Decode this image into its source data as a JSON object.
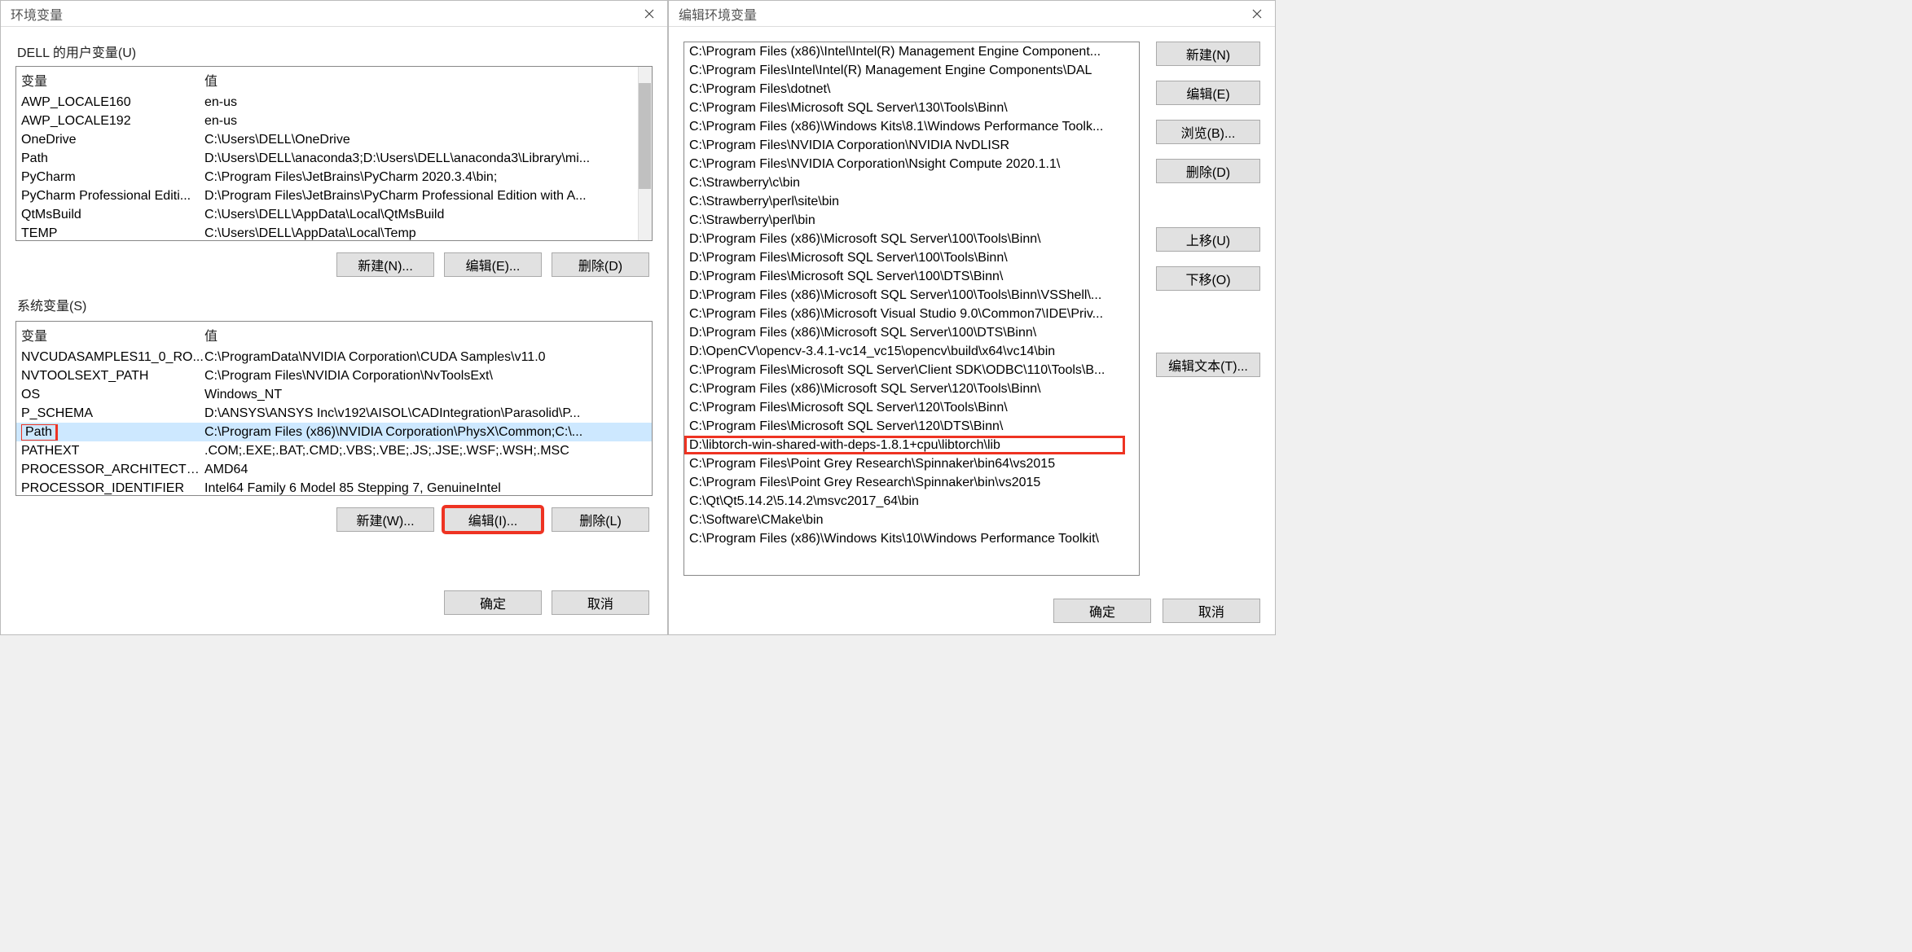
{
  "left_dialog": {
    "title": "环境变量",
    "user_section_label": "DELL 的用户变量(U)",
    "sys_section_label": "系统变量(S)",
    "col_var": "变量",
    "col_val": "值",
    "user_vars": [
      {
        "name": "AWP_LOCALE160",
        "value": "en-us"
      },
      {
        "name": "AWP_LOCALE192",
        "value": "en-us"
      },
      {
        "name": "OneDrive",
        "value": "C:\\Users\\DELL\\OneDrive"
      },
      {
        "name": "Path",
        "value": "D:\\Users\\DELL\\anaconda3;D:\\Users\\DELL\\anaconda3\\Library\\mi..."
      },
      {
        "name": "PyCharm",
        "value": "C:\\Program Files\\JetBrains\\PyCharm 2020.3.4\\bin;"
      },
      {
        "name": "PyCharm Professional Editi...",
        "value": "D:\\Program Files\\JetBrains\\PyCharm Professional Edition with A..."
      },
      {
        "name": "QtMsBuild",
        "value": "C:\\Users\\DELL\\AppData\\Local\\QtMsBuild"
      },
      {
        "name": "TEMP",
        "value": "C:\\Users\\DELL\\AppData\\Local\\Temp"
      }
    ],
    "sys_vars": [
      {
        "name": "NVCUDASAMPLES11_0_RO...",
        "value": "C:\\ProgramData\\NVIDIA Corporation\\CUDA Samples\\v11.0"
      },
      {
        "name": "NVTOOLSEXT_PATH",
        "value": "C:\\Program Files\\NVIDIA Corporation\\NvToolsExt\\"
      },
      {
        "name": "OS",
        "value": "Windows_NT"
      },
      {
        "name": "P_SCHEMA",
        "value": "D:\\ANSYS\\ANSYS Inc\\v192\\AISOL\\CADIntegration\\Parasolid\\P..."
      },
      {
        "name": "Path",
        "value": "C:\\Program Files (x86)\\NVIDIA Corporation\\PhysX\\Common;C:\\...",
        "highlight": true,
        "selected": true
      },
      {
        "name": "PATHEXT",
        "value": ".COM;.EXE;.BAT;.CMD;.VBS;.VBE;.JS;.JSE;.WSF;.WSH;.MSC"
      },
      {
        "name": "PROCESSOR_ARCHITECTU...",
        "value": "AMD64"
      },
      {
        "name": "PROCESSOR_IDENTIFIER",
        "value": "Intel64 Family 6 Model 85 Stepping 7, GenuineIntel"
      }
    ],
    "buttons": {
      "user_new": "新建(N)...",
      "user_edit": "编辑(E)...",
      "user_del": "删除(D)",
      "sys_new": "新建(W)...",
      "sys_edit": "编辑(I)...",
      "sys_del": "删除(L)",
      "ok": "确定",
      "cancel": "取消"
    }
  },
  "right_dialog": {
    "title": "编辑环境变量",
    "items": [
      "C:\\Program Files (x86)\\Intel\\Intel(R) Management Engine Component...",
      "C:\\Program Files\\Intel\\Intel(R) Management Engine Components\\DAL",
      "C:\\Program Files\\dotnet\\",
      "C:\\Program Files\\Microsoft SQL Server\\130\\Tools\\Binn\\",
      "C:\\Program Files (x86)\\Windows Kits\\8.1\\Windows Performance Toolk...",
      "C:\\Program Files\\NVIDIA Corporation\\NVIDIA NvDLISR",
      "C:\\Program Files\\NVIDIA Corporation\\Nsight Compute 2020.1.1\\",
      "C:\\Strawberry\\c\\bin",
      "C:\\Strawberry\\perl\\site\\bin",
      "C:\\Strawberry\\perl\\bin",
      "D:\\Program Files (x86)\\Microsoft SQL Server\\100\\Tools\\Binn\\",
      "D:\\Program Files\\Microsoft SQL Server\\100\\Tools\\Binn\\",
      "D:\\Program Files\\Microsoft SQL Server\\100\\DTS\\Binn\\",
      "D:\\Program Files (x86)\\Microsoft SQL Server\\100\\Tools\\Binn\\VSShell\\...",
      "C:\\Program Files (x86)\\Microsoft Visual Studio 9.0\\Common7\\IDE\\Priv...",
      "D:\\Program Files (x86)\\Microsoft SQL Server\\100\\DTS\\Binn\\",
      "D:\\OpenCV\\opencv-3.4.1-vc14_vc15\\opencv\\build\\x64\\vc14\\bin",
      "C:\\Program Files\\Microsoft SQL Server\\Client SDK\\ODBC\\110\\Tools\\B...",
      "C:\\Program Files (x86)\\Microsoft SQL Server\\120\\Tools\\Binn\\",
      "C:\\Program Files\\Microsoft SQL Server\\120\\Tools\\Binn\\",
      "C:\\Program Files\\Microsoft SQL Server\\120\\DTS\\Binn\\",
      "D:\\libtorch-win-shared-with-deps-1.8.1+cpu\\libtorch\\lib",
      "C:\\Program Files\\Point Grey Research\\Spinnaker\\bin64\\vs2015",
      "C:\\Program Files\\Point Grey Research\\Spinnaker\\bin\\vs2015",
      "C:\\Qt\\Qt5.14.2\\5.14.2\\msvc2017_64\\bin",
      "C:\\Software\\CMake\\bin",
      "C:\\Program Files (x86)\\Windows Kits\\10\\Windows Performance Toolkit\\"
    ],
    "highlight_index": 21,
    "buttons": {
      "new": "新建(N)",
      "edit": "编辑(E)",
      "browse": "浏览(B)...",
      "delete": "删除(D)",
      "up": "上移(U)",
      "down": "下移(O)",
      "edit_text": "编辑文本(T)...",
      "ok": "确定",
      "cancel": "取消"
    }
  }
}
